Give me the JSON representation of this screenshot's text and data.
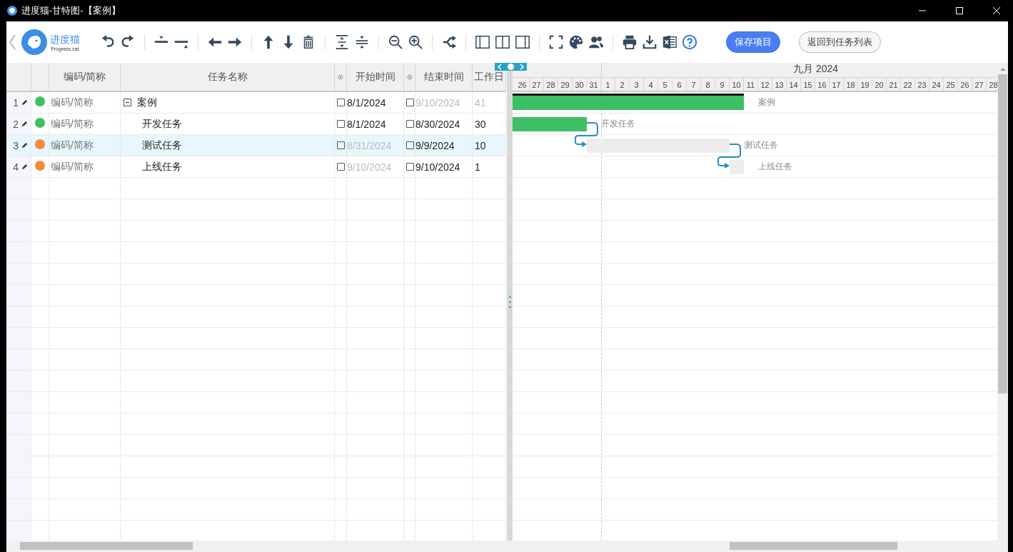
{
  "window": {
    "title": "进度猫-甘特图-【案例】"
  },
  "logo": {
    "name": "进度猫",
    "tagline": "Progress cat"
  },
  "buttons": [
    {
      "label": "保存项目",
      "kind": "primary"
    },
    {
      "label": "返回到任务列表",
      "kind": "secondary"
    }
  ],
  "table": {
    "columns": [
      "编码/简称",
      "任务名称",
      "开始时间",
      "结束时间",
      "工作日"
    ],
    "rows": [
      {
        "number": "1",
        "color": "#3dbf64",
        "code": "编码/简称",
        "name": "案例",
        "expanded": true,
        "selected": false,
        "start": "8/1/2024",
        "start_checked": false,
        "start_dimmed": false,
        "end": "9/10/2024",
        "end_checked": false,
        "end_dimmed": true,
        "workdays": "41",
        "workdays_dimmed": true,
        "bar_label": "案例",
        "bar_complete": true,
        "children": [
          {
            "number": "2",
            "color": "#3dbf64",
            "code": "编码/简称",
            "name": "开发任务",
            "selected": false,
            "start": "8/1/2024",
            "start_checked": false,
            "start_dimmed": false,
            "end": "8/30/2024",
            "end_checked": false,
            "end_dimmed": false,
            "workdays": "30",
            "workdays_dimmed": false,
            "bar_label": "开发任务",
            "bar_complete": true,
            "linked_from_previous": false
          },
          {
            "number": "3",
            "color": "#f28c38",
            "code": "编码/简称",
            "name": "测试任务",
            "selected": true,
            "start": "8/31/2024",
            "start_checked": false,
            "start_dimmed": true,
            "end": "9/9/2024",
            "end_checked": false,
            "end_dimmed": false,
            "workdays": "10",
            "workdays_dimmed": false,
            "bar_label": "测试任务",
            "bar_complete": false,
            "linked_from_previous": true
          },
          {
            "number": "4",
            "color": "#f28c38",
            "code": "编码/简称",
            "name": "上线任务",
            "selected": false,
            "start": "9/10/2024",
            "start_checked": false,
            "start_dimmed": true,
            "end": "9/10/2024",
            "end_checked": false,
            "end_dimmed": false,
            "workdays": "1",
            "workdays_dimmed": false,
            "bar_label": "上线任务",
            "bar_complete": false,
            "linked_from_previous": true
          }
        ]
      }
    ]
  },
  "gantt": {
    "month": "九月 2024",
    "days_before": [
      "26",
      "27",
      "28",
      "29",
      "30",
      "31"
    ],
    "days": [
      "1",
      "2",
      "3",
      "4",
      "5",
      "6",
      "7",
      "8",
      "9",
      "10",
      "11",
      "12",
      "13",
      "14",
      "15",
      "16",
      "17",
      "18",
      "19",
      "20",
      "21",
      "22",
      "23",
      "24",
      "25",
      "26",
      "27",
      "28"
    ]
  }
}
